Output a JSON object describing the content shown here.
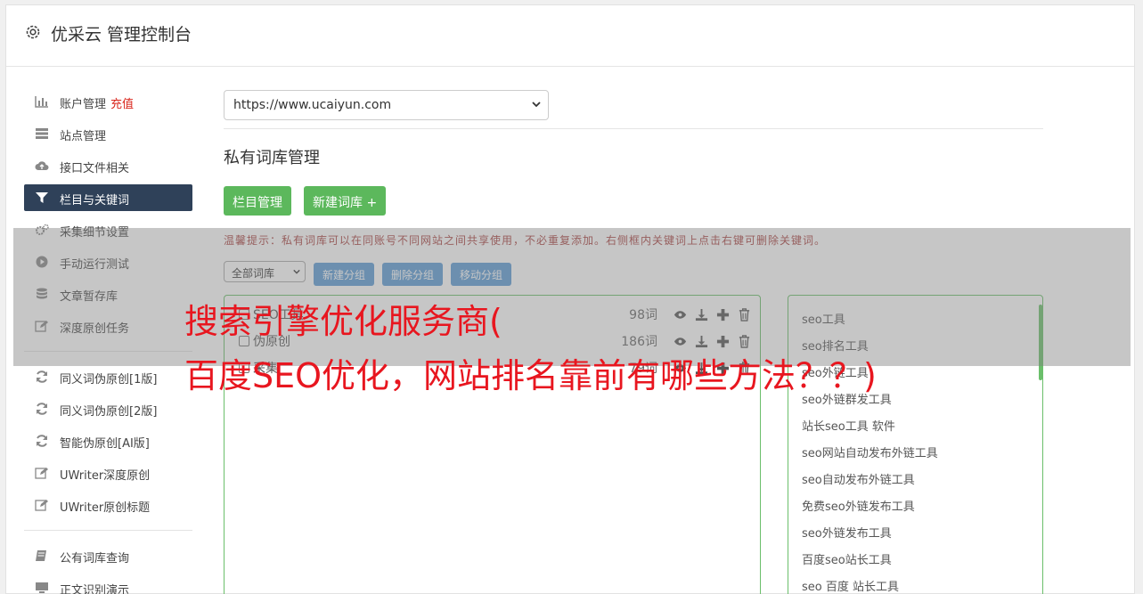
{
  "header": {
    "title": "优采云 管理控制台"
  },
  "sidebar": {
    "items": [
      {
        "label": "账户管理",
        "badge": "充值",
        "icon": "bar-chart-icon"
      },
      {
        "label": "站点管理",
        "icon": "server-icon"
      },
      {
        "label": "接口文件相关",
        "icon": "cloud-upload-icon"
      },
      {
        "label": "栏目与关键词",
        "icon": "filter-icon",
        "active": true
      },
      {
        "label": "采集细节设置",
        "icon": "gears-icon"
      },
      {
        "label": "手动运行测试",
        "icon": "play-circle-icon"
      },
      {
        "label": "文章暂存库",
        "icon": "database-icon"
      },
      {
        "label": "深度原创任务",
        "icon": "edit-icon"
      },
      {
        "label": "同义词伪原创[1版]",
        "icon": "refresh-icon"
      },
      {
        "label": "同义词伪原创[2版]",
        "icon": "refresh-icon"
      },
      {
        "label": "智能伪原创[AI版]",
        "icon": "refresh-icon"
      },
      {
        "label": "UWriter深度原创",
        "icon": "edit-icon"
      },
      {
        "label": "UWriter原创标题",
        "icon": "edit-icon"
      },
      {
        "label": "公有词库查询",
        "icon": "book-icon"
      },
      {
        "label": "正文识别演示",
        "icon": "monitor-icon"
      }
    ]
  },
  "site_select": {
    "value": "https://www.ucaiyun.com"
  },
  "section": {
    "title": "私有词库管理"
  },
  "buttons": {
    "columns": "栏目管理",
    "new_library": "新建词库 +"
  },
  "tip": "温馨提示：私有词库可以在同账号不同网站之间共享使用，不必重复添加。右侧框内关键词上点击右键可删除关键词。",
  "library_filter": {
    "value": "全部词库"
  },
  "group_buttons": {
    "new_group": "新建分组",
    "delete_group": "删除分组",
    "move_group": "移动分组"
  },
  "libraries": [
    {
      "name": "SEO工具",
      "count": "98词"
    },
    {
      "name": "伪原创",
      "count": "186词"
    },
    {
      "name": "采集",
      "count": "79词"
    }
  ],
  "keywords": [
    "seo工具",
    "seo排名工具",
    "seo外链工具",
    "seo外链群发工具",
    "站长seo工具 软件",
    "seo网站自动发布外链工具",
    "seo自动发布外链工具",
    "免费seo外链发布工具",
    "seo外链发布工具",
    "百度seo站长工具",
    "seo 百度 站长工具"
  ],
  "overlay": {
    "line1": "搜索引擎优化服务商(",
    "line2": "百度SEO优化，网站排名靠前有哪些方法？？)"
  },
  "colors": {
    "active_nav": "#2f4159",
    "green_button": "#5cb85c",
    "blue_button": "#5b9bd5",
    "recharge": "#d9251c",
    "headline": "#e8161f"
  }
}
